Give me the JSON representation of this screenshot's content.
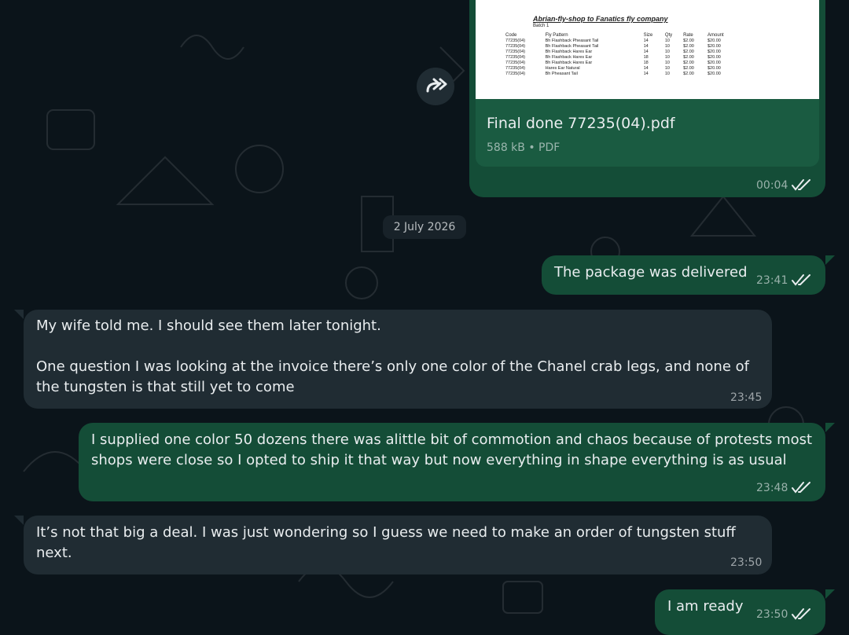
{
  "attachment": {
    "filename": "Final done 77235(04).pdf",
    "meta": "588 kB • PDF",
    "time": "00:04",
    "preview": {
      "title": "Abrian-fly-shop to Fanatics fly company",
      "batch": "Batch 1",
      "headers": [
        "Code",
        "Fly Pattern",
        "Size",
        "Qty",
        "Rate",
        "Amount"
      ],
      "rows": [
        [
          "77235(04)",
          "Bh Flashback Pheasant Tail",
          "14",
          "10",
          "$2.00",
          "$20.00"
        ],
        [
          "77235(04)",
          "Bh Flashback Pheasant Tail",
          "14",
          "10",
          "$2.00",
          "$20.00"
        ],
        [
          "77235(04)",
          "Bh Flashback Hares Ear",
          "14",
          "10",
          "$2.00",
          "$20.00"
        ],
        [
          "77235(04)",
          "Bh Flashback Hares Ear",
          "18",
          "10",
          "$2.00",
          "$20.00"
        ],
        [
          "77235(04)",
          "Bh Flashback Hares Ear",
          "18",
          "10",
          "$2.00",
          "$20.00"
        ],
        [
          "77235(04)",
          "Hares Ear Natural",
          "14",
          "10",
          "$2.00",
          "$20.00"
        ],
        [
          "77235(04)",
          "Bh Pheasant Tail",
          "14",
          "10",
          "$2.00",
          "$20.00"
        ]
      ]
    }
  },
  "date_separator": "2 July 2026",
  "messages": [
    {
      "text": "The package was delivered",
      "time": "23:41"
    },
    {
      "text": "My wife told me. I should see them later tonight.\n\nOne question I was looking at the invoice there’s only one color of the Chanel crab legs, and none of\nthe tungsten is that still yet to come",
      "time": "23:45"
    },
    {
      "text": "I supplied one color 50 dozens there was alittle bit of commotion and chaos because of protests most\nshops were close so I opted to ship it that way but now everything in shape everything is as usual",
      "time": "23:48"
    },
    {
      "text": "It’s not that big a deal. I was just wondering so I guess we need to make an order of tungsten stuff\nnext.",
      "time": "23:50"
    },
    {
      "text": "I am ready",
      "time": "23:50"
    }
  ],
  "icons": {
    "forward": "forward-icon",
    "read_receipt": "double-check-icon"
  },
  "colors": {
    "background": "#0b141a",
    "outgoing_bubble": "#144d37",
    "incoming_bubble": "#202c33",
    "read_tick": "#e9edef"
  }
}
